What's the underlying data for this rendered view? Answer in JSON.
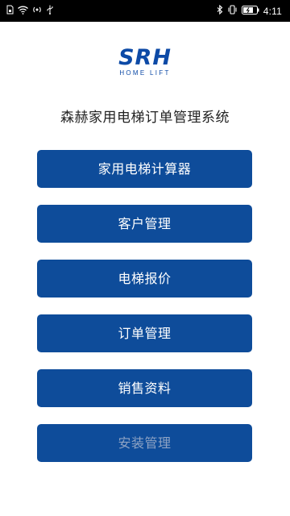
{
  "status_bar": {
    "time": "4:11",
    "left_icons": [
      "sim-icon",
      "wifi-icon",
      "hotspot-icon",
      "usb-icon"
    ],
    "right_icons": [
      "bluetooth-icon",
      "vibrate-icon",
      "battery-icon"
    ]
  },
  "logo": {
    "main": "SRH",
    "sub": "HOME LIFT",
    "color": "#0d4aa6"
  },
  "app_title": "森赫家用电梯订单管理系统",
  "menu": {
    "button_color": "#0e4c9a",
    "items": [
      {
        "label": "家用电梯计算器"
      },
      {
        "label": "客户管理"
      },
      {
        "label": "电梯报价"
      },
      {
        "label": "订单管理"
      },
      {
        "label": "销售资料"
      },
      {
        "label": "安装管理"
      }
    ]
  }
}
